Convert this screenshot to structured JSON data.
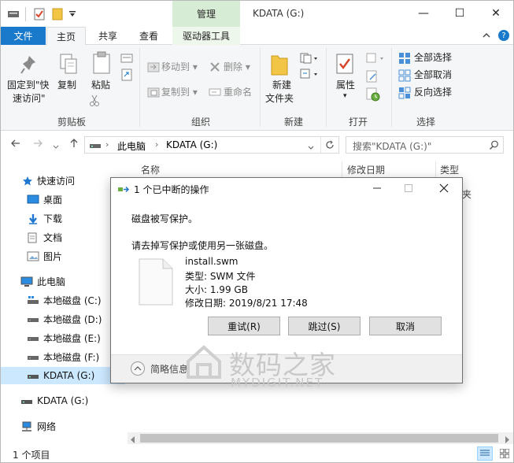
{
  "titlebar": {
    "manage_tab": "管理",
    "title": "KDATA (G:)",
    "minimize": "—",
    "maximize": "☐",
    "close": "✕"
  },
  "tabs": {
    "file": "文件",
    "home": "主页",
    "share": "共享",
    "view": "查看",
    "drive_tools": "驱动器工具"
  },
  "ribbon": {
    "pin_line1": "固定到\"快",
    "pin_line2": "速访问\"",
    "copy": "复制",
    "paste": "粘贴",
    "clipboard": "剪贴板",
    "move_to": "移动到",
    "copy_to": "复制到",
    "delete": "删除",
    "rename": "重命名",
    "organize": "组织",
    "new_folder_line1": "新建",
    "new_folder_line2": "文件夹",
    "new": "新建",
    "properties": "属性",
    "open": "打开",
    "select_all": "全部选择",
    "select_none": "全部取消",
    "invert_selection": "反向选择",
    "select": "选择"
  },
  "address": {
    "crumb1": "此电脑",
    "crumb2": "KDATA (G:)",
    "search_placeholder": "搜索\"KDATA (G:)\""
  },
  "nav": {
    "quick_access": "快速访问",
    "desktop": "桌面",
    "downloads": "下载",
    "documents": "文档",
    "pictures": "图片",
    "this_pc": "此电脑",
    "disk_c": "本地磁盘 (C:)",
    "disk_d": "本地磁盘 (D:)",
    "disk_e": "本地磁盘 (E:)",
    "disk_f": "本地磁盘 (F:)",
    "kdata_sel": "KDATA (G:)",
    "kdata": "KDATA (G:)",
    "network": "网络"
  },
  "columns": {
    "name": "名称",
    "modified": "修改日期",
    "type": "类型",
    "type_cell_partial": "夹"
  },
  "status": {
    "items": "1 个项目"
  },
  "dialog": {
    "title": "1 个已中断的操作",
    "message": "磁盘被写保护。",
    "instruction": "请去掉写保护或使用另一张磁盘。",
    "filename": "install.swm",
    "type": "类型: SWM 文件",
    "size": "大小: 1.99 GB",
    "modified": "修改日期: 2019/8/21 17:48",
    "retry": "重试(R)",
    "skip": "跳过(S)",
    "cancel": "取消",
    "details": "简略信息"
  },
  "watermark": {
    "cn": "数码之家",
    "en": "MYDIGIT.NET"
  },
  "colors": {
    "file_tab": "#1979ca",
    "manage_tab": "#d7ecd4",
    "selection": "#cce8ff",
    "folder": "#f3c547"
  },
  "icons": [
    "pin-icon",
    "copy-icon",
    "paste-icon",
    "cut-icon",
    "move-to-icon",
    "copy-to-icon",
    "delete-icon",
    "rename-icon",
    "new-folder-icon",
    "new-item-icon",
    "properties-icon",
    "open-icon",
    "select-all-icon",
    "select-none-icon",
    "invert-selection-icon",
    "back-icon",
    "forward-icon",
    "up-icon",
    "refresh-icon",
    "search-icon",
    "star-icon",
    "drive-icon",
    "computer-icon",
    "network-icon",
    "file-icon",
    "chevron-up-icon"
  ]
}
